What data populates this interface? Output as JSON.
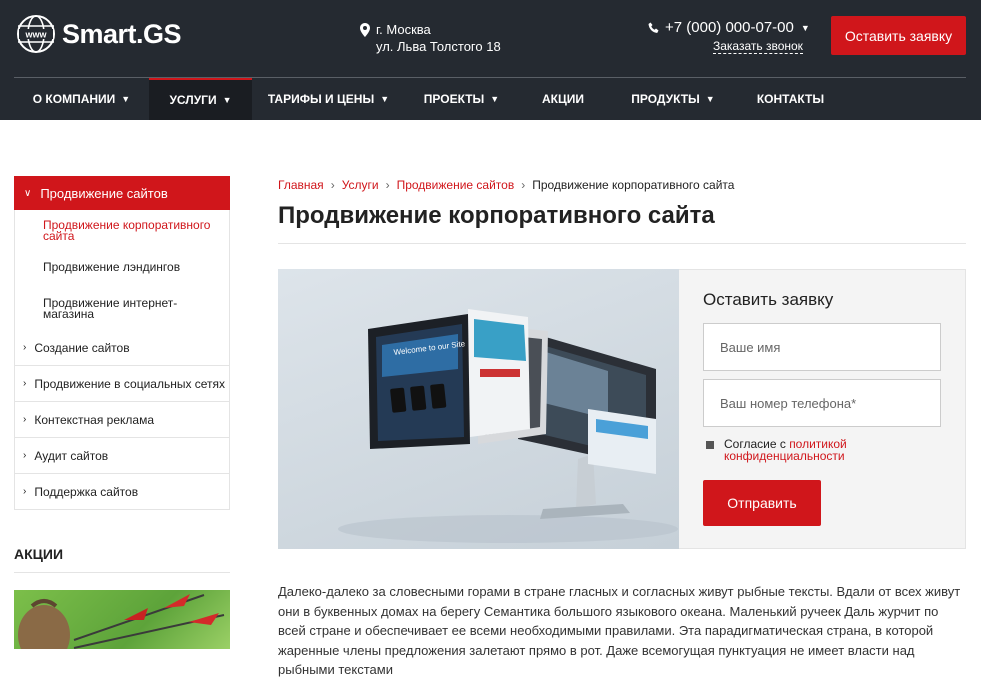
{
  "header": {
    "logo_text": "Smart.GS",
    "logo_globe_text": "www",
    "address_city": "г. Москва",
    "address_street": "ул. Льва Толстого 18",
    "phone": "+7 (000) 000-07-00",
    "callback_link": "Заказать звонок",
    "request_button": "Оставить заявку"
  },
  "nav": {
    "items": [
      {
        "label": "О компании",
        "dropdown": true,
        "active": false
      },
      {
        "label": "Услуги",
        "dropdown": true,
        "active": true
      },
      {
        "label": "Тарифы и цены",
        "dropdown": true,
        "active": false
      },
      {
        "label": "Проекты",
        "dropdown": true,
        "active": false
      },
      {
        "label": "Акции",
        "dropdown": false,
        "active": false
      },
      {
        "label": "Продукты",
        "dropdown": true,
        "active": false
      },
      {
        "label": "Контакты",
        "dropdown": false,
        "active": false
      }
    ]
  },
  "sidebar": {
    "active_item": "Продвижение сайтов",
    "sub_items": [
      "Продвижение корпоративного сайта",
      "Продвижение лэндингов",
      "Продвижение интернет-магазина"
    ],
    "items": [
      "Создание сайтов",
      "Продвижение в социальных сетях",
      "Контекстная реклама",
      "Аудит сайтов",
      "Поддержка сайтов"
    ],
    "promo_heading": "АКЦИИ"
  },
  "breadcrumb": {
    "items": [
      "Главная",
      "Услуги",
      "Продвижение сайтов"
    ],
    "current": "Продвижение корпоративного сайта"
  },
  "page": {
    "title": "Продвижение корпоративного сайта",
    "body_text": "Далеко-далеко за словесными горами в стране гласных и согласных живут рыбные тексты. Вдали от всех живут они в буквенных домах на берегу Семантика большого языкового океана. Маленький ручеек Даль журчит по всей стране и обеспечивает ее всеми необходимыми правилами. Эта парадигматическая страна, в которой жаренные члены предложения залетают прямо в рот. Даже всемогущая пунктуация не имеет власти над рыбными текстами"
  },
  "hero": {
    "screen_caption": "Welcome to our Site"
  },
  "form": {
    "title": "Оставить заявку",
    "name_placeholder": "Ваше имя",
    "phone_placeholder": "Ваш номер телефона*",
    "agree_prefix": "Согласие с ",
    "agree_link_1": "политикой",
    "agree_link_2": "конфиденциальности",
    "submit_button": "Отправить"
  },
  "colors": {
    "accent": "#d0161b",
    "header_bg": "#252a31"
  }
}
